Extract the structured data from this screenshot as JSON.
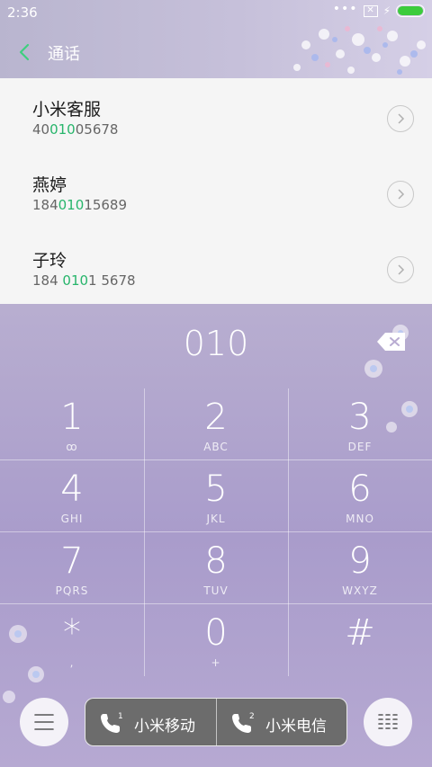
{
  "status_bar": {
    "time": "2:36",
    "overflow": "•••",
    "no_sim_symbol": "✕",
    "bolt": "⚡"
  },
  "header": {
    "title": "通话"
  },
  "results": [
    {
      "name": "小米客服",
      "number_prefix": "40",
      "number_match": "010",
      "number_suffix": "05678"
    },
    {
      "name": "燕婷",
      "number_prefix": "184",
      "number_match": "010",
      "number_suffix": "15689"
    },
    {
      "name": "子玲",
      "number_prefix": "184 ",
      "number_match": "010",
      "number_suffix": "1 5678"
    }
  ],
  "dialer": {
    "entered_number": "010",
    "keys": [
      {
        "digit": "1",
        "sub": "ꝏ"
      },
      {
        "digit": "2",
        "sub": "ABC"
      },
      {
        "digit": "3",
        "sub": "DEF"
      },
      {
        "digit": "4",
        "sub": "GHI"
      },
      {
        "digit": "5",
        "sub": "JKL"
      },
      {
        "digit": "6",
        "sub": "MNO"
      },
      {
        "digit": "7",
        "sub": "PQRS"
      },
      {
        "digit": "8",
        "sub": "TUV"
      },
      {
        "digit": "9",
        "sub": "WXYZ"
      },
      {
        "digit": "*",
        "sub": ","
      },
      {
        "digit": "0",
        "sub": "+"
      },
      {
        "digit": "#",
        "sub": ""
      }
    ]
  },
  "bottom_bar": {
    "sim1_label": "小米移动",
    "sim1_badge": "1",
    "sim2_label": "小米电信",
    "sim2_badge": "2"
  },
  "colors": {
    "match_highlight": "#27b56b",
    "battery": "#3ccc3c",
    "call_group_bg": "#6c6c6c"
  },
  "icons": [
    "back-arrow-icon",
    "no-sim-icon",
    "charging-icon",
    "battery-icon",
    "chevron-right-icon",
    "backspace-icon",
    "menu-icon",
    "phone-icon",
    "dialpad-icon"
  ]
}
